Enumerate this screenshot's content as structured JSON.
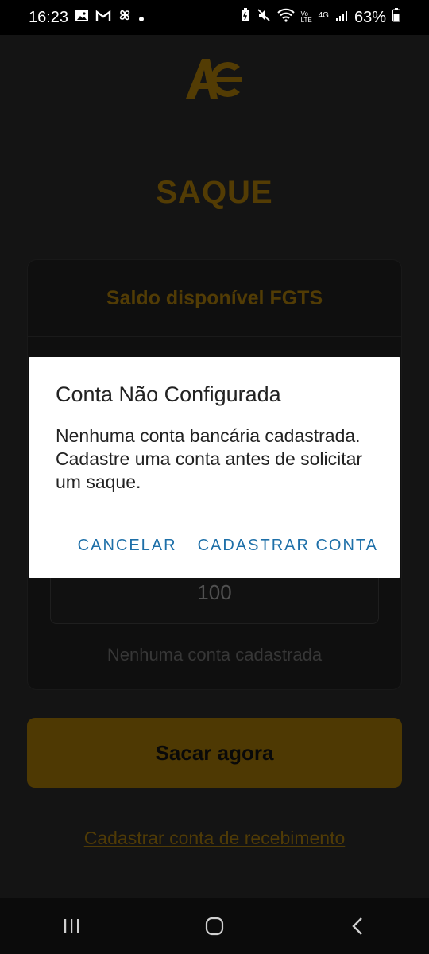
{
  "status_bar": {
    "time": "16:23",
    "battery": "63%",
    "icons_left": [
      "gallery-icon",
      "gmail-icon",
      "pinwheel-icon",
      "dot-icon"
    ],
    "icons_right": [
      "battery-saver-icon",
      "mute-icon",
      "wifi-icon",
      "volte-icon",
      "4g-icon",
      "signal-icon",
      "battery-icon"
    ],
    "volte_label": "Vo LTE",
    "network_label": "4G"
  },
  "app": {
    "logo": "AC",
    "title": "SAQUE",
    "card_header": "Saldo disponível FGTS",
    "amount_value": "100",
    "no_account_text": "Nenhuma conta cadastrada",
    "primary_button": "Sacar agora",
    "register_link": "Cadastrar conta de recebimento",
    "accent_color": "#6f5106"
  },
  "dialog": {
    "title": "Conta Não Configurada",
    "message_line1": "Nenhuma conta bancária cadastrada.",
    "message_line2": "Cadastre uma conta antes de solicitar um saque.",
    "cancel_button": "CANCELAR",
    "confirm_button": "CADASTRAR CONTA",
    "button_color": "#1d6fa8"
  },
  "nav_bar": {
    "buttons": [
      "recents-icon",
      "home-icon",
      "back-icon"
    ]
  }
}
